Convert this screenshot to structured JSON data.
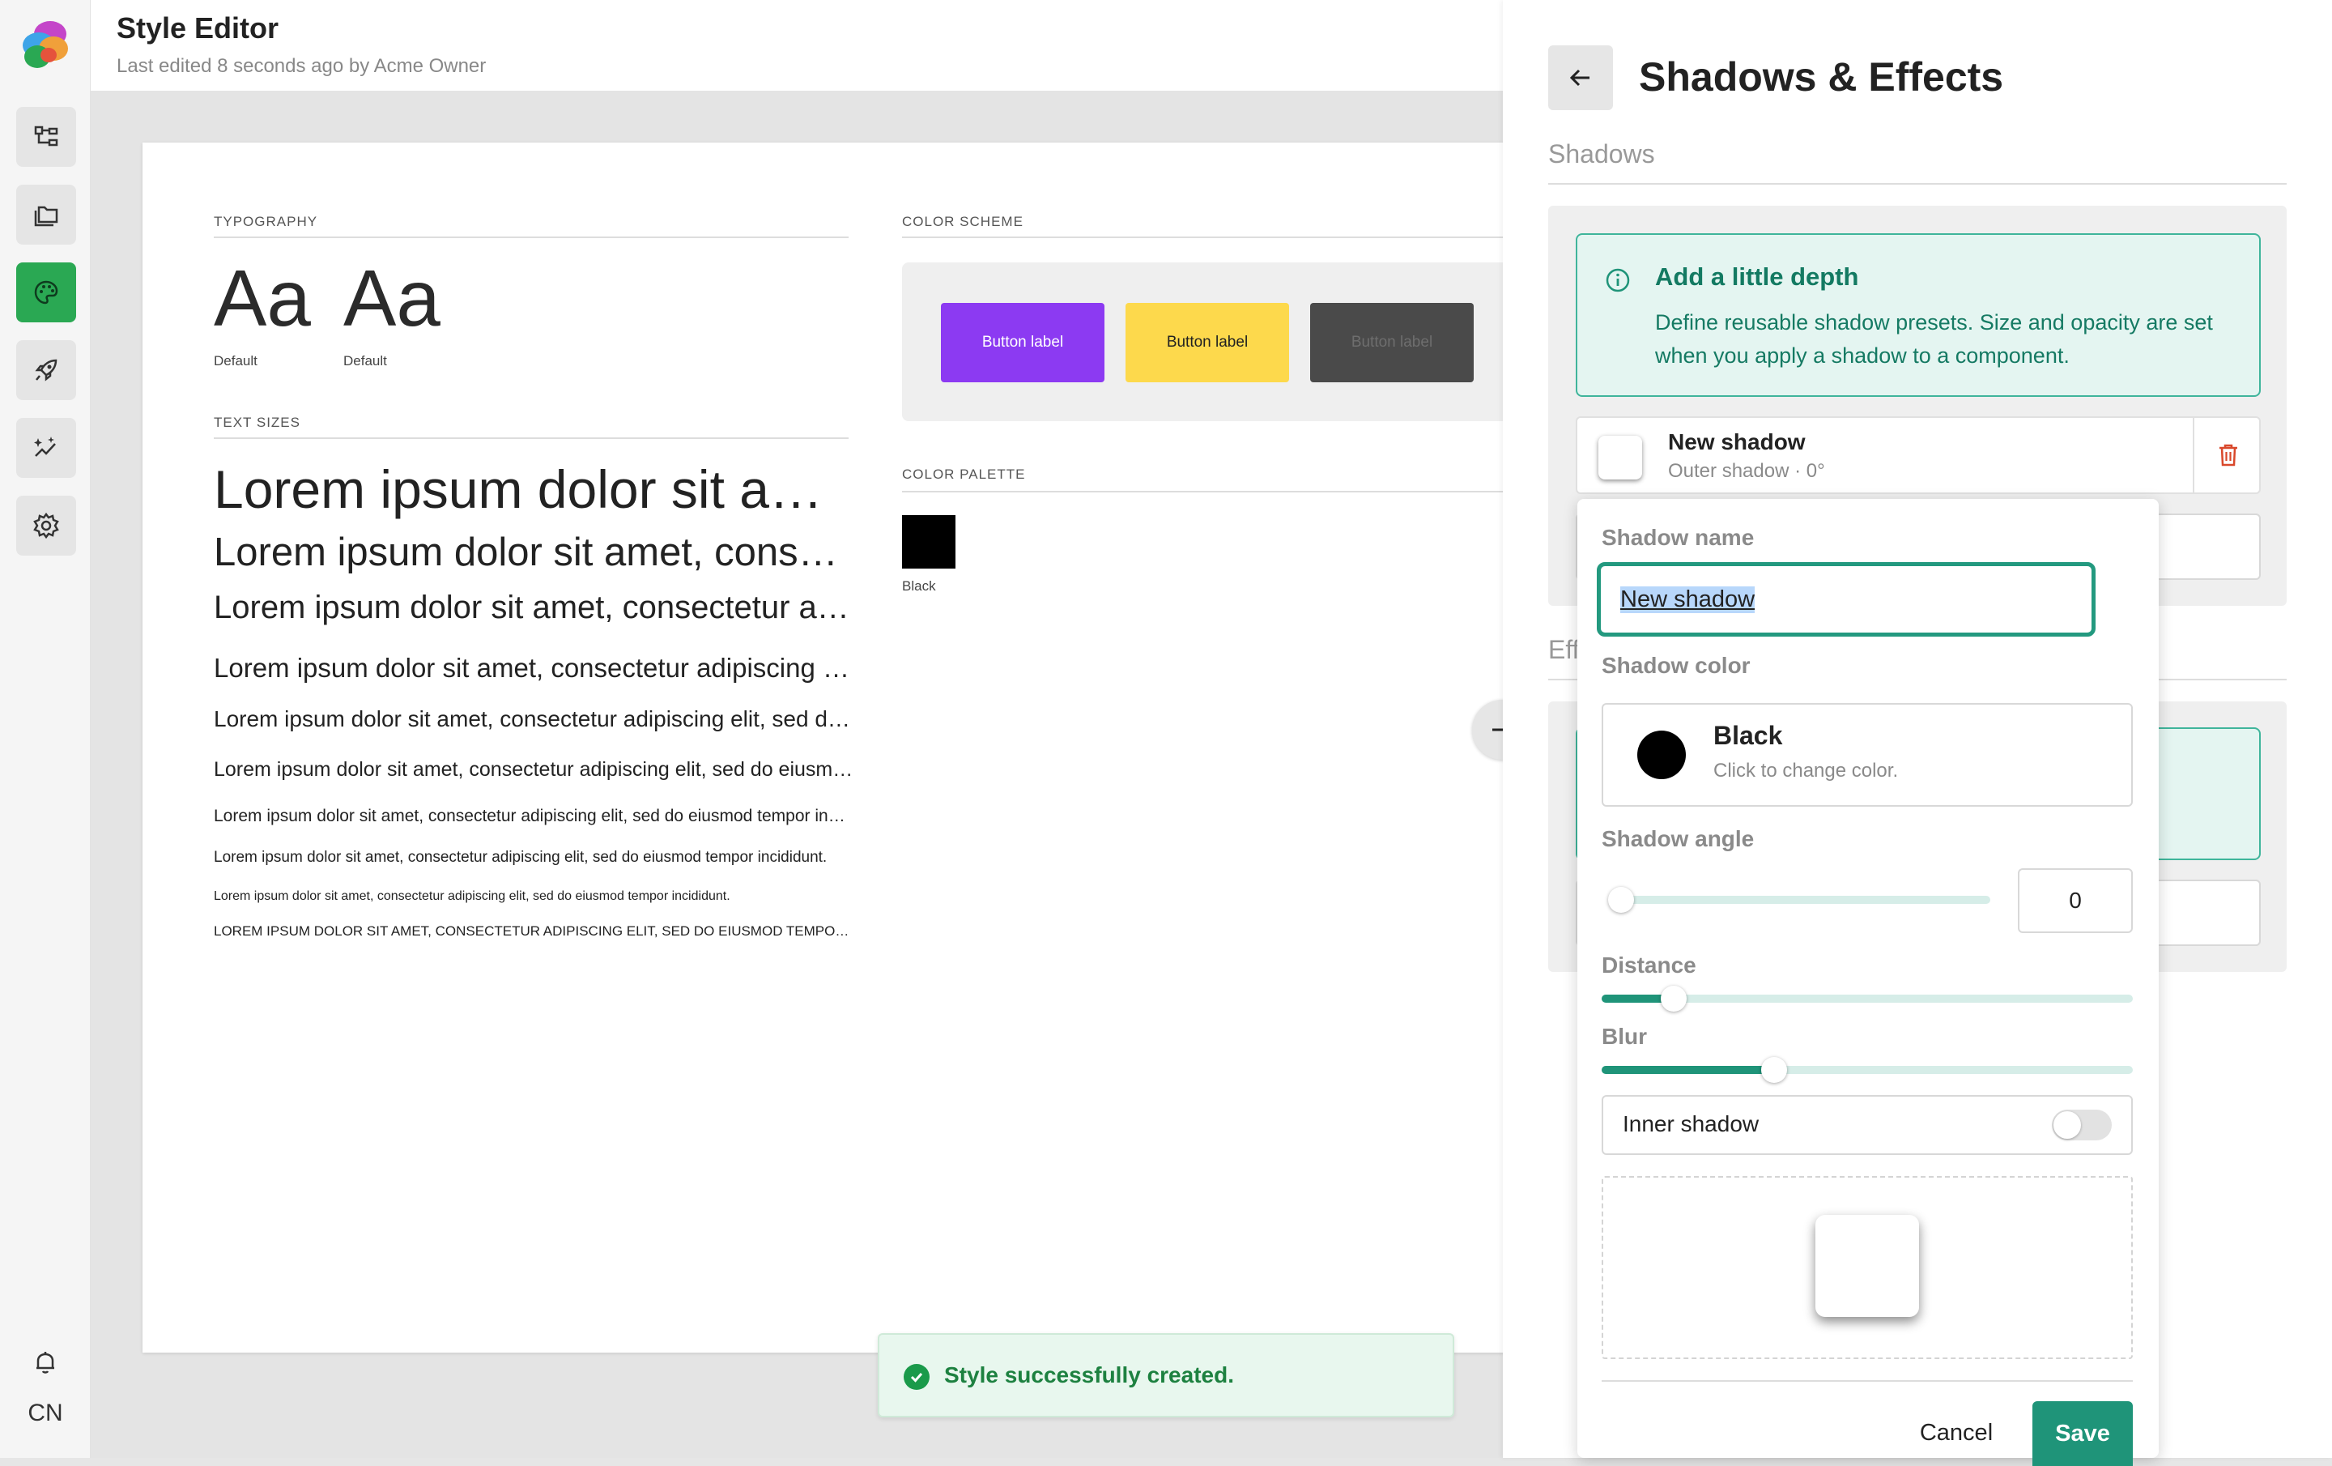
{
  "app": {
    "title": "Style Editor",
    "subtitle": "Last edited 8 seconds ago by Acme Owner",
    "user_initials": "CN"
  },
  "sheet": {
    "typography_label": "TYPOGRAPHY",
    "font_samples": [
      {
        "glyph": "Aa",
        "caption": "Default"
      },
      {
        "glyph": "Aa",
        "caption": "Default"
      }
    ],
    "text_sizes_label": "TEXT SIZES",
    "text_sizes": [
      "Lorem ipsum dolor sit amet, consectetur adipiscing elit, sed do eiusmod tempor incididunt.",
      "Lorem ipsum dolor sit amet, consectetur adipiscing elit, sed do eiusmod tempor incididunt.",
      "Lorem ipsum dolor sit amet, consectetur adipiscing elit, sed do eiusmod tempor incididunt.",
      "Lorem ipsum dolor sit amet, consectetur adipiscing elit, sed do eiusmod tempor incididunt.",
      "Lorem ipsum dolor sit amet, consectetur adipiscing elit, sed do eiusmod tempor incididunt.",
      "Lorem ipsum dolor sit amet, consectetur adipiscing elit, sed do eiusmod tempor incididunt.",
      "Lorem ipsum dolor sit amet, consectetur adipiscing elit, sed do eiusmod tempor incididunt.",
      "Lorem ipsum dolor sit amet, consectetur adipiscing elit, sed do eiusmod tempor incididunt.",
      "Lorem ipsum dolor sit amet, consectetur adipiscing elit, sed do eiusmod tempor incididunt.",
      "LOREM IPSUM DOLOR SIT AMET, CONSECTETUR ADIPISCING ELIT, SED DO EIUSMOD TEMPOR INCIDIDUNT."
    ],
    "color_scheme_label": "COLOR SCHEME",
    "scheme_buttons": [
      {
        "label": "Button label",
        "bg": "#8c3af2",
        "fg": "#ffffff"
      },
      {
        "label": "Button label",
        "bg": "#fdd94c",
        "fg": "#222222"
      },
      {
        "label": "Button label",
        "bg": "#4a4a4a",
        "fg": "#6e6e6e"
      }
    ],
    "color_palette_label": "COLOR PALETTE",
    "palette": [
      {
        "name": "Black",
        "hex": "#000000"
      }
    ]
  },
  "panel": {
    "title": "Shadows & Effects",
    "shadows_section": "Shadows",
    "effects_section": "Eff",
    "info": {
      "title": "Add a little depth",
      "body": "Define reusable shadow presets. Size and opacity are set when you apply a shadow to a component."
    },
    "shadow_item": {
      "name": "New shadow",
      "meta": "Outer shadow · 0°"
    }
  },
  "popover": {
    "name_label": "Shadow name",
    "name_value": "New shadow",
    "color_label": "Shadow color",
    "color_name": "Black",
    "color_hint": "Click to change color.",
    "color_hex": "#000000",
    "angle_label": "Shadow angle",
    "angle_value": "0",
    "angle_level": 0,
    "distance_label": "Distance",
    "distance_level": 0.12,
    "blur_label": "Blur",
    "blur_level": 0.31,
    "inner_label": "Inner shadow",
    "inner_enabled": false,
    "cancel_label": "Cancel",
    "save_label": "Save"
  },
  "toast": {
    "message": "Style successfully created."
  },
  "colors": {
    "accent": "#1f9479",
    "active_nav": "#2aa853",
    "success": "#1a9a4a",
    "danger": "#d9482b"
  }
}
